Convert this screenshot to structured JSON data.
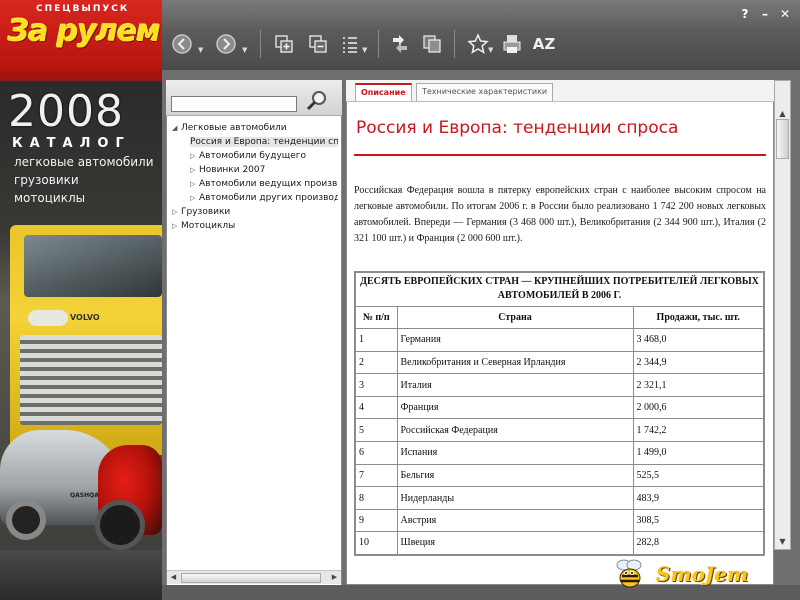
{
  "branding": {
    "special_issue": "СПЕЦВЫПУСК",
    "logo": "За рулем",
    "year": "2008",
    "catalog_word": "КАТАЛОГ",
    "categories": [
      "легковые автомобили",
      "грузовики",
      "мотоциклы"
    ],
    "truck_badge": "VOLVO",
    "car_badge": "QASHQAI"
  },
  "window": {
    "help": "?",
    "minimize": "–",
    "close": "✕"
  },
  "toolbar": {
    "icons": [
      "back-icon",
      "forward-icon",
      "expand-all-icon",
      "collapse-all-icon",
      "list-icon",
      "sync-icon",
      "copy-icon",
      "favorite-icon",
      "print-icon",
      "sort-az-icon"
    ],
    "sort_label": "AZ"
  },
  "search": {
    "value": "",
    "placeholder": ""
  },
  "tree": {
    "items": [
      {
        "label": "Легковые автомобили",
        "expanded": true,
        "level": 0
      },
      {
        "label": "Россия и Европа: тенденции спр",
        "level": 1,
        "selected": true
      },
      {
        "label": "Автомобили будущего",
        "level": 1
      },
      {
        "label": "Новинки 2007",
        "level": 1
      },
      {
        "label": "Автомобили ведущих производ",
        "level": 1
      },
      {
        "label": "Автомобили других производит",
        "level": 1
      },
      {
        "label": "Грузовики",
        "level": 0
      },
      {
        "label": "Мотоциклы",
        "level": 0
      }
    ]
  },
  "tabs": [
    {
      "label": "Описание",
      "active": true
    },
    {
      "label": "Технические характеристики",
      "active": false
    }
  ],
  "article": {
    "title": "Россия и Европа: тенденции спроса",
    "body": "Российская Федерация вошла в пятерку европейских стран с наиболее высоким спросом на легковые автомобили. По итогам 2006 г. в России было реализовано 1 742 200 новых легковых автомобилей. Впереди — Германия (3 468 000 шт.), Великобритания (2 344 900 шт.), Италия (2 321 100 шт.) и Франция (2 000 600 шт.)."
  },
  "table": {
    "caption": "ДЕСЯТЬ ЕВРОПЕЙСКИХ СТРАН — КРУПНЕЙШИХ ПОТРЕБИТЕЛЕЙ ЛЕГКОВЫХ АВТОМОБИЛЕЙ В 2006 Г.",
    "headers": [
      "№ п/п",
      "Страна",
      "Продажи, тыс. шт."
    ],
    "rows": [
      [
        "1",
        "Германия",
        "3 468,0"
      ],
      [
        "2",
        "Великобритания и Северная Ирландия",
        "2 344,9"
      ],
      [
        "3",
        "Италия",
        "2 321,1"
      ],
      [
        "4",
        "Франция",
        "2 000,6"
      ],
      [
        "5",
        "Российская Федерация",
        "1 742,2"
      ],
      [
        "6",
        "Испания",
        "1 499,0"
      ],
      [
        "7",
        "Бельгия",
        "525,5"
      ],
      [
        "8",
        "Нидерланды",
        "483,9"
      ],
      [
        "9",
        "Австрия",
        "308,5"
      ],
      [
        "10",
        "Швеция",
        "282,8"
      ]
    ]
  },
  "watermark": "SmoJem",
  "colors": {
    "accent_red": "#c8161d",
    "logo_yellow": "#ffdf1e",
    "toolbar_gray": "#5b5b5b"
  }
}
